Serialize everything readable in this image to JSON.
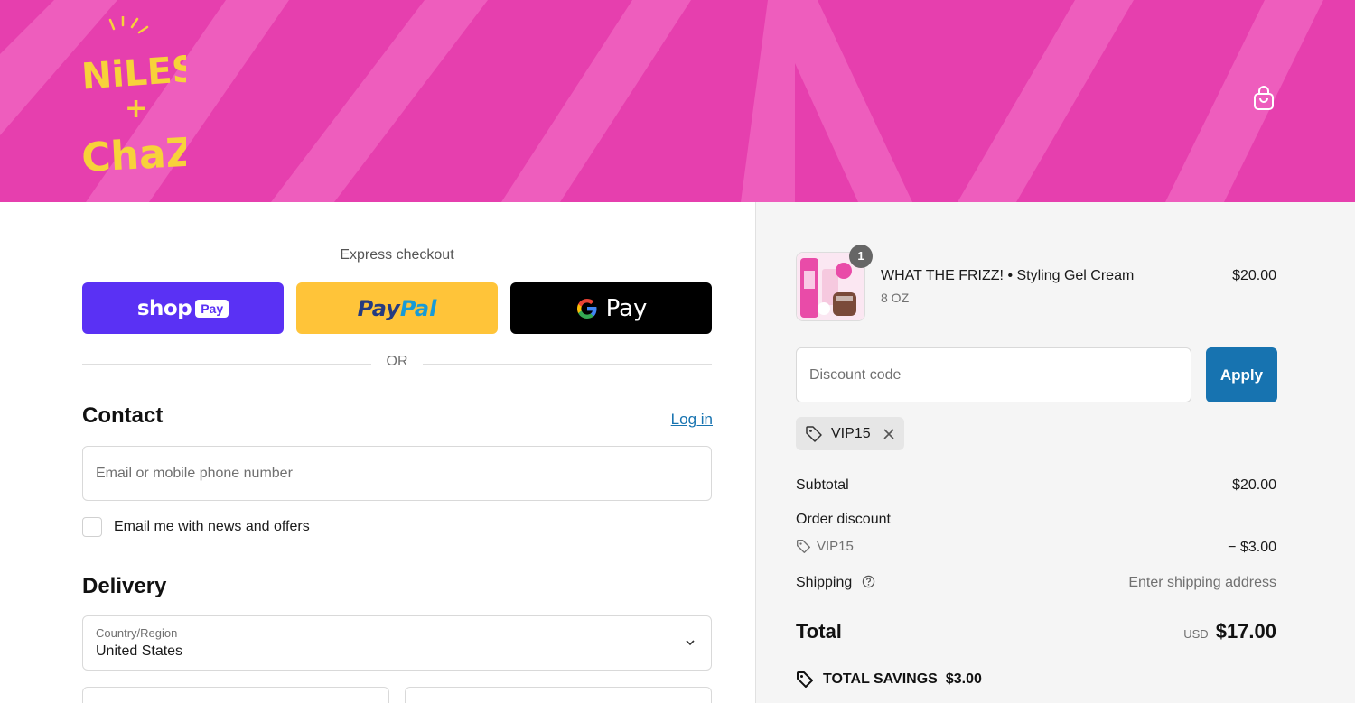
{
  "brand": {
    "logo_line1": "NiLES",
    "logo_plus": "+",
    "logo_line2": "ChaZ",
    "header_color": "#e63fae"
  },
  "express": {
    "label": "Express checkout",
    "shop_pay": {
      "word": "shop",
      "pill": "Pay"
    },
    "paypal": {
      "part1": "Pay",
      "part2": "Pal"
    },
    "gpay": {
      "g": "G",
      "text": "Pay"
    },
    "or": "OR"
  },
  "contact": {
    "title": "Contact",
    "login_label": "Log in",
    "email_placeholder": "Email or mobile phone number",
    "newsletter_label": "Email me with news and offers"
  },
  "delivery": {
    "title": "Delivery",
    "country_label": "Country/Region",
    "country_value": "United States"
  },
  "summary": {
    "item": {
      "name": "WHAT THE FRIZZ! • Styling Gel Cream",
      "variant": "8 OZ",
      "price": "$20.00",
      "quantity": "1"
    },
    "discount_placeholder": "Discount code",
    "apply_label": "Apply",
    "applied_code": "VIP15",
    "subtotal_label": "Subtotal",
    "subtotal_value": "$20.00",
    "order_discount_label": "Order discount",
    "order_discount_code": "VIP15",
    "order_discount_value": "− $3.00",
    "shipping_label": "Shipping",
    "shipping_value": "Enter shipping address",
    "total_label": "Total",
    "total_currency": "USD",
    "total_value": "$17.00",
    "savings_label": "TOTAL SAVINGS",
    "savings_value": "$3.00"
  },
  "colors": {
    "accent": "#1773b0",
    "shop_pay": "#5a31f4",
    "paypal": "#ffc439",
    "logo_yellow": "#f7d23a"
  },
  "icons": [
    "cart-icon",
    "tag-icon",
    "close-icon",
    "help-icon",
    "chevron-down-icon",
    "savings-tag-icon"
  ]
}
